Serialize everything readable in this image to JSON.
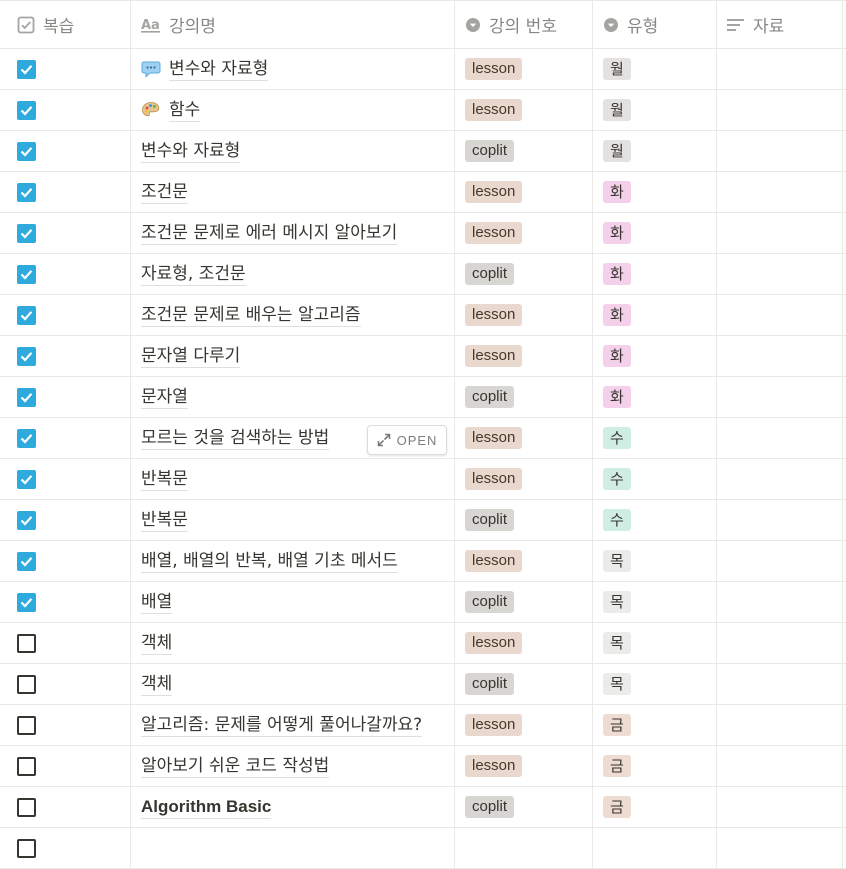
{
  "columns": [
    {
      "label": "복습",
      "icon": "checkbox-icon"
    },
    {
      "label": "강의명",
      "icon": "title-aa-icon"
    },
    {
      "label": "강의 번호",
      "icon": "select-icon"
    },
    {
      "label": "유형",
      "icon": "select-icon"
    },
    {
      "label": "자료",
      "icon": "text-lines-icon"
    }
  ],
  "open_button": {
    "label": "OPEN",
    "icon": "expand-icon"
  },
  "day_colors": {
    "월": "#e3e2e0",
    "화": "#f5d0ea",
    "수": "#d0ede4",
    "목": "#ebebea",
    "금": "#eedcd2"
  },
  "rows": [
    {
      "checked": true,
      "title": "변수와 자료형",
      "emoji": "speech-bubble-icon",
      "number": "lesson",
      "type": "월"
    },
    {
      "checked": true,
      "title": "함수",
      "emoji": "palette-icon",
      "number": "lesson",
      "type": "월"
    },
    {
      "checked": true,
      "title": "변수와 자료형",
      "number": "coplit",
      "type": "월"
    },
    {
      "checked": true,
      "title": "조건문",
      "number": "lesson",
      "type": "화"
    },
    {
      "checked": true,
      "title": "조건문 문제로 에러 메시지 알아보기",
      "number": "lesson",
      "type": "화"
    },
    {
      "checked": true,
      "title": "자료형, 조건문",
      "number": "coplit",
      "type": "화"
    },
    {
      "checked": true,
      "title": "조건문 문제로 배우는 알고리즘",
      "number": "lesson",
      "type": "화"
    },
    {
      "checked": true,
      "title": "문자열 다루기",
      "number": "lesson",
      "type": "화"
    },
    {
      "checked": true,
      "title": "문자열",
      "number": "coplit",
      "type": "화"
    },
    {
      "checked": true,
      "title": "모르는 것을 검색하는 방법",
      "number": "lesson",
      "type": "수",
      "hover_open": true
    },
    {
      "checked": true,
      "title": "반복문",
      "number": "lesson",
      "type": "수"
    },
    {
      "checked": true,
      "title": "반복문",
      "number": "coplit",
      "type": "수"
    },
    {
      "checked": true,
      "title": "배열, 배열의 반복, 배열 기초 메서드",
      "number": "lesson",
      "type": "목"
    },
    {
      "checked": true,
      "title": "배열",
      "number": "coplit",
      "type": "목"
    },
    {
      "checked": false,
      "title": "객체",
      "number": "lesson",
      "type": "목"
    },
    {
      "checked": false,
      "title": "객체",
      "number": "coplit",
      "type": "목"
    },
    {
      "checked": false,
      "title": "알고리즘: 문제를 어떻게 풀어나갈까요?",
      "number": "lesson",
      "type": "금"
    },
    {
      "checked": false,
      "title": "알아보기 쉬운 코드 작성법",
      "number": "lesson",
      "type": "금"
    },
    {
      "checked": false,
      "title": "Algorithm Basic",
      "number": "coplit",
      "type": "금",
      "latin": true
    },
    {
      "checked": false,
      "title": "",
      "number": "",
      "type": ""
    }
  ]
}
